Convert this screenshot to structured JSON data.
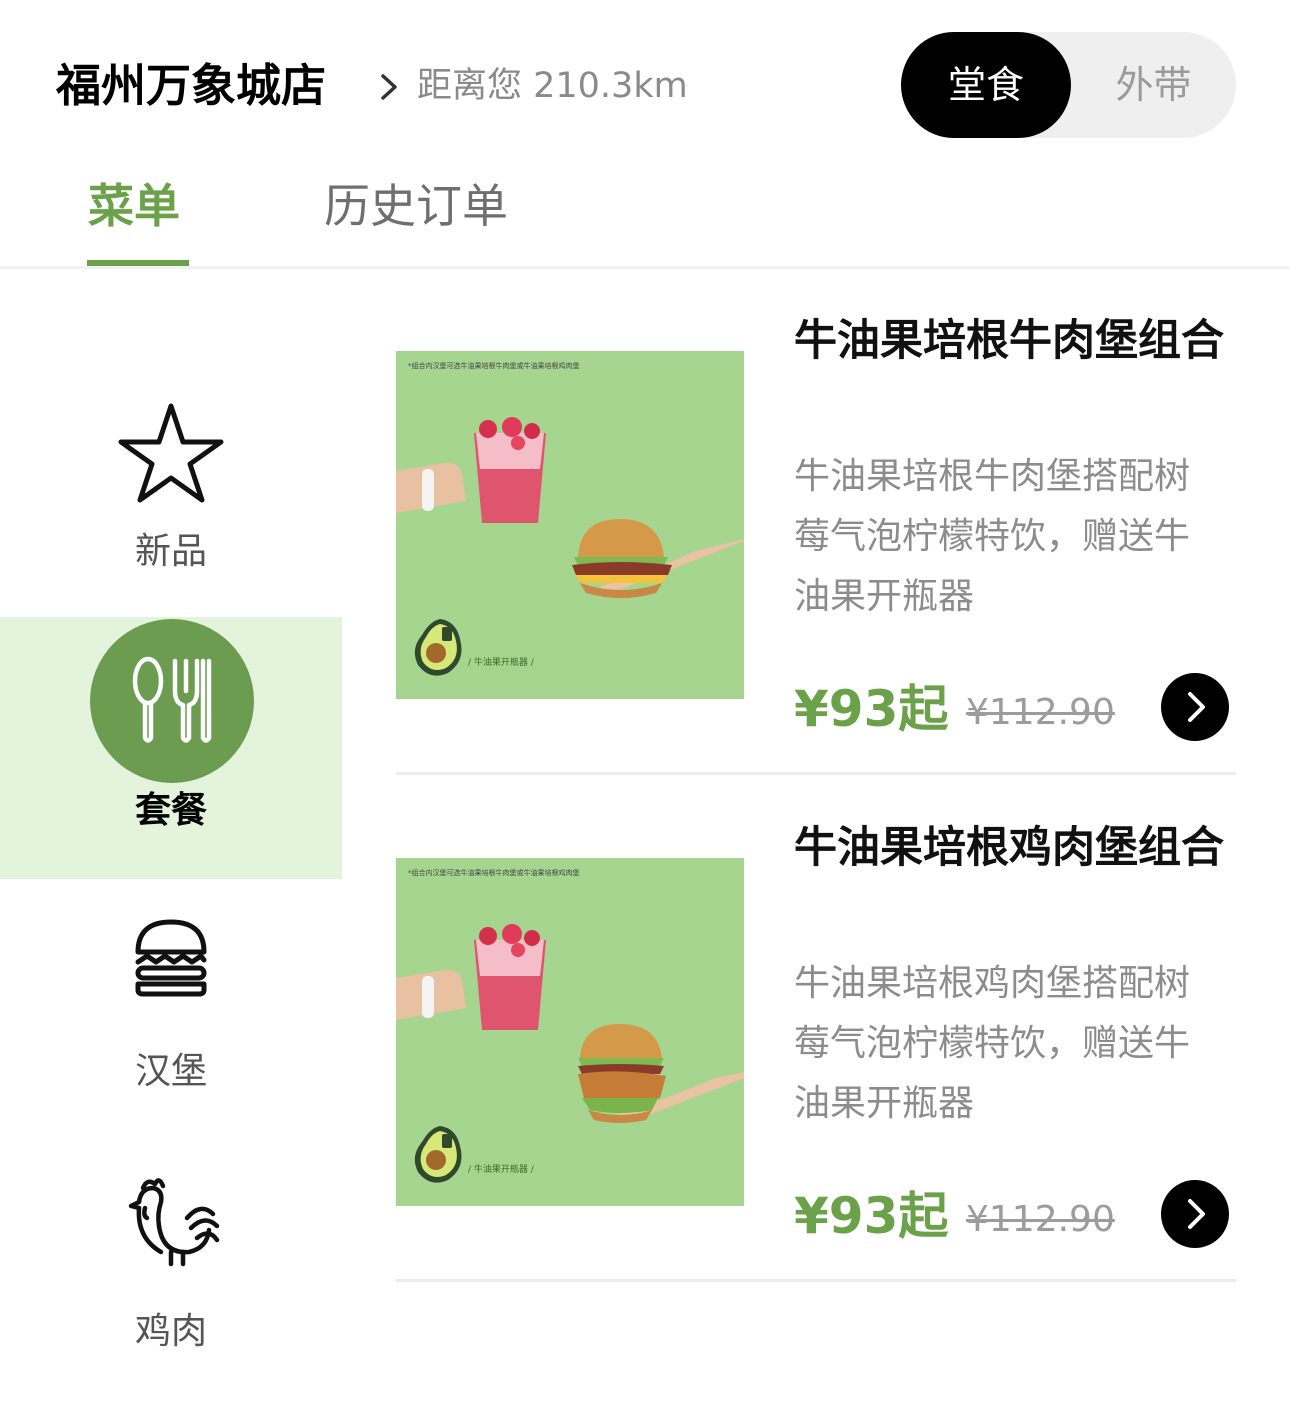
{
  "header": {
    "store_name": "福州万象城店",
    "distance": "距离您 210.3km",
    "mode_options": [
      "堂食",
      "外带"
    ],
    "selected_mode": "堂食"
  },
  "tabs": [
    {
      "label": "菜单",
      "active": true
    },
    {
      "label": "历史订单",
      "active": false
    }
  ],
  "sidebar": {
    "items": [
      {
        "label": "新品",
        "icon": "star-icon",
        "selected": false
      },
      {
        "label": "套餐",
        "icon": "utensils-icon",
        "selected": true
      },
      {
        "label": "汉堡",
        "icon": "burger-icon",
        "selected": false
      },
      {
        "label": "鸡肉",
        "icon": "rooster-icon",
        "selected": false
      }
    ]
  },
  "products": [
    {
      "title": "牛油果培根牛肉堡组合",
      "description": "牛油果培根牛肉堡搭配树莓气泡柠檬特饮，赠送牛油果开瓶器",
      "price": "¥93起",
      "original_price": "¥112.90",
      "image_note": "*组合内汉堡可选牛油果培根牛肉堡或牛油果培根鸡肉堡",
      "image_caption": "/ 牛油果开瓶器 /"
    },
    {
      "title": "牛油果培根鸡肉堡组合",
      "description": "牛油果培根鸡肉堡搭配树莓气泡柠檬特饮，赠送牛油果开瓶器",
      "price": "¥93起",
      "original_price": "¥112.90",
      "image_note": "*组合内汉堡可选牛油果培根牛肉堡或牛油果培根鸡肉堡",
      "image_caption": "/ 牛油果开瓶器 /"
    }
  ],
  "colors": {
    "accent_green": "#6ba249",
    "selected_bg": "#e4f3dc",
    "product_image_bg": "#a6d58f"
  }
}
